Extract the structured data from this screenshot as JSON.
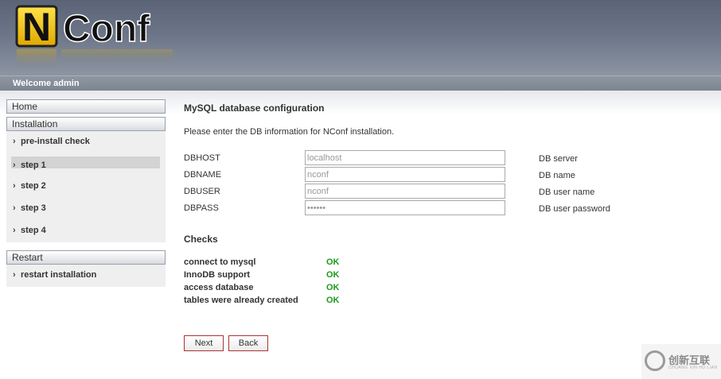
{
  "header": {
    "logo_text": "NConf",
    "welcome": "Welcome admin"
  },
  "sidebar": {
    "home": "Home",
    "installation": {
      "title": "Installation",
      "items": [
        {
          "label": "pre-install check"
        },
        {
          "label": "step 1",
          "active": true
        },
        {
          "label": "step 2"
        },
        {
          "label": "step 3"
        },
        {
          "label": "step 4"
        }
      ]
    },
    "restart": {
      "title": "Restart",
      "items": [
        {
          "label": "restart installation"
        }
      ]
    },
    "chevron": "›"
  },
  "main": {
    "title": "MySQL database configuration",
    "intro": "Please enter the DB information for NConf installation.",
    "fields": [
      {
        "label": "DBHOST",
        "value": "localhost",
        "help": "DB server"
      },
      {
        "label": "DBNAME",
        "value": "nconf",
        "help": "DB name"
      },
      {
        "label": "DBUSER",
        "value": "nconf",
        "help": "DB user name"
      },
      {
        "label": "DBPASS",
        "value": "nconf!",
        "help": "DB user password"
      }
    ],
    "checks_title": "Checks",
    "checks": [
      {
        "name": "connect to mysql",
        "status": "OK"
      },
      {
        "name": "InnoDB support",
        "status": "OK"
      },
      {
        "name": "access database",
        "status": "OK"
      },
      {
        "name": "tables were already created",
        "status": "OK"
      }
    ],
    "next_label": "Next",
    "back_label": "Back"
  },
  "watermark": {
    "text": "创新互联",
    "sub": "CHUANG XIN HU LIAN"
  },
  "colors": {
    "ok_green": "#1a9a1a",
    "header_dark": "#5a6476",
    "logo_yellow": "#f5c400"
  }
}
